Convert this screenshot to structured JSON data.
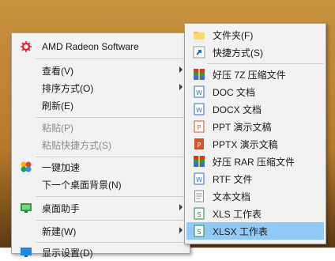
{
  "context_menu": {
    "items": [
      {
        "label": "AMD Radeon Software"
      },
      {
        "label": "查看(V)"
      },
      {
        "label": "排序方式(O)"
      },
      {
        "label": "刷新(E)"
      },
      {
        "label": "粘贴(P)"
      },
      {
        "label": "粘贴快捷方式(S)"
      },
      {
        "label": "一键加速"
      },
      {
        "label": "下一个桌面背景(N)"
      },
      {
        "label": "桌面助手"
      },
      {
        "label": "新建(W)"
      },
      {
        "label": "显示设置(D)"
      }
    ]
  },
  "new_submenu": {
    "items": [
      {
        "label": "文件夹(F)"
      },
      {
        "label": "快捷方式(S)"
      },
      {
        "label": "好压 7Z 压缩文件"
      },
      {
        "label": "DOC 文档"
      },
      {
        "label": "DOCX 文档"
      },
      {
        "label": "PPT 演示文稿"
      },
      {
        "label": "PPTX 演示文稿"
      },
      {
        "label": "好压 RAR 压缩文件"
      },
      {
        "label": "RTF 文件"
      },
      {
        "label": "文本文档"
      },
      {
        "label": "XLS 工作表"
      },
      {
        "label": "XLSX 工作表"
      }
    ]
  },
  "colors": {
    "highlight": "#91c9f7",
    "menu_bg": "#f2f2f2",
    "amd_red": "#e0202e"
  }
}
